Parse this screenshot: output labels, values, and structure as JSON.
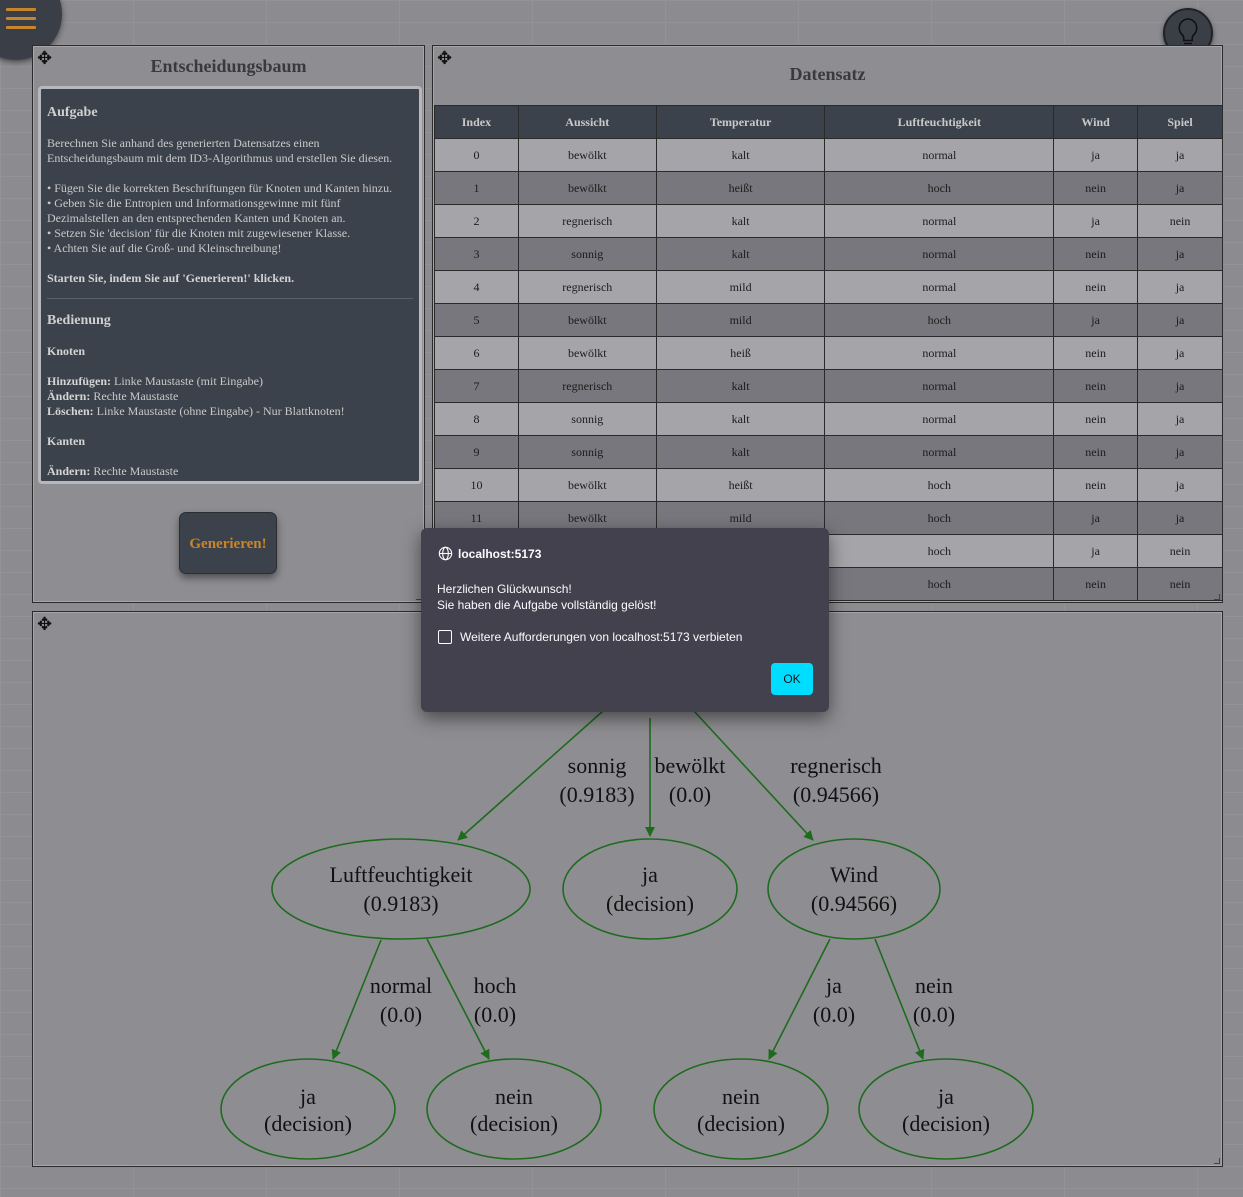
{
  "app": {
    "menu_icon": "hamburger-menu-icon",
    "hint_icon": "lightbulb-icon"
  },
  "left_panel": {
    "title": "Entscheidungsbaum",
    "task_heading": "Aufgabe",
    "task_text": "Berechnen Sie anhand des generierten Datensatzes einen Entscheidungsbaum mit dem ID3-Algorithmus und erstellen Sie diesen.",
    "bullets": [
      "• Fügen Sie die korrekten Beschriftungen für Knoten und Kanten hinzu.",
      "• Geben Sie die Entropien und Informationsgewinne mit fünf Dezimalstellen an den entsprechenden Kanten und Knoten an.",
      "• Setzen Sie 'decision' für die Knoten mit zugewiesener Klasse.",
      "• Achten Sie auf die Groß- und Kleinschreibung!"
    ],
    "start_text": "Starten Sie, indem Sie auf 'Generieren!' klicken.",
    "controls_heading": "Bedienung",
    "nodes_heading": "Knoten",
    "add_label": "Hinzufügen:",
    "add_text": " Linke Maustaste (mit Eingabe)",
    "change_label": "Ändern:",
    "change_text": " Rechte Maustaste",
    "delete_label": "Löschen:",
    "delete_text": " Linke Maustaste (ohne Eingabe) - Nur Blattknoten!",
    "edges_heading": "Kanten",
    "edges_change_label": "Ändern:",
    "edges_change_text": " Rechte Maustaste",
    "generate_button": "Generieren!"
  },
  "dataset_panel": {
    "title": "Datensatz",
    "columns": [
      "Index",
      "Aussicht",
      "Temperatur",
      "Luftfeuchtigkeit",
      "Wind",
      "Spiel"
    ],
    "rows": [
      [
        "0",
        "bewölkt",
        "kalt",
        "normal",
        "ja",
        "ja"
      ],
      [
        "1",
        "bewölkt",
        "heißt",
        "hoch",
        "nein",
        "ja"
      ],
      [
        "2",
        "regnerisch",
        "kalt",
        "normal",
        "ja",
        "nein"
      ],
      [
        "3",
        "sonnig",
        "kalt",
        "normal",
        "nein",
        "ja"
      ],
      [
        "4",
        "regnerisch",
        "mild",
        "normal",
        "nein",
        "ja"
      ],
      [
        "5",
        "bewölkt",
        "mild",
        "hoch",
        "ja",
        "ja"
      ],
      [
        "6",
        "bewölkt",
        "heiß",
        "normal",
        "nein",
        "ja"
      ],
      [
        "7",
        "regnerisch",
        "kalt",
        "normal",
        "nein",
        "ja"
      ],
      [
        "8",
        "sonnig",
        "kalt",
        "normal",
        "nein",
        "ja"
      ],
      [
        "9",
        "sonnig",
        "kalt",
        "normal",
        "nein",
        "ja"
      ],
      [
        "10",
        "bewölkt",
        "heißt",
        "hoch",
        "nein",
        "ja"
      ],
      [
        "11",
        "bewölkt",
        "mild",
        "hoch",
        "ja",
        "ja"
      ],
      [
        "",
        "",
        "",
        "hoch",
        "ja",
        "nein"
      ],
      [
        "",
        "",
        "",
        "hoch",
        "nein",
        "nein"
      ]
    ]
  },
  "tree": {
    "nodes": [
      {
        "id": "luft",
        "line1": "Luftfeuchtigkeit",
        "line2": "(0.9183)"
      },
      {
        "id": "ja_mid",
        "line1": "ja",
        "line2": "(decision)"
      },
      {
        "id": "wind",
        "line1": "Wind",
        "line2": "(0.94566)"
      },
      {
        "id": "ja_l",
        "line1": "ja",
        "line2": "(decision)"
      },
      {
        "id": "nein_l",
        "line1": "nein",
        "line2": "(decision)"
      },
      {
        "id": "nein_r",
        "line1": "nein",
        "line2": "(decision)"
      },
      {
        "id": "ja_r",
        "line1": "ja",
        "line2": "(decision)"
      }
    ],
    "edges": [
      {
        "id": "sonnig",
        "line1": "sonnig",
        "line2": "(0.9183)"
      },
      {
        "id": "bewoelkt",
        "line1": "bewölkt",
        "line2": "(0.0)"
      },
      {
        "id": "regnerisch",
        "line1": "regnerisch",
        "line2": "(0.94566)"
      },
      {
        "id": "normal",
        "line1": "normal",
        "line2": "(0.0)"
      },
      {
        "id": "hoch",
        "line1": "hoch",
        "line2": "(0.0)"
      },
      {
        "id": "ja",
        "line1": "ja",
        "line2": "(0.0)"
      },
      {
        "id": "nein",
        "line1": "nein",
        "line2": "(0.0)"
      }
    ],
    "stroke_color": "#1e6b1e"
  },
  "dialog": {
    "origin": "localhost:5173",
    "line1": "Herzlichen Glückwunsch!",
    "line2": "Sie haben die Aufgabe vollständig gelöst!",
    "checkbox_label": "Weitere Aufforderungen von localhost:5173 verbieten",
    "ok_label": "OK",
    "ok_color": "#00ddff"
  }
}
